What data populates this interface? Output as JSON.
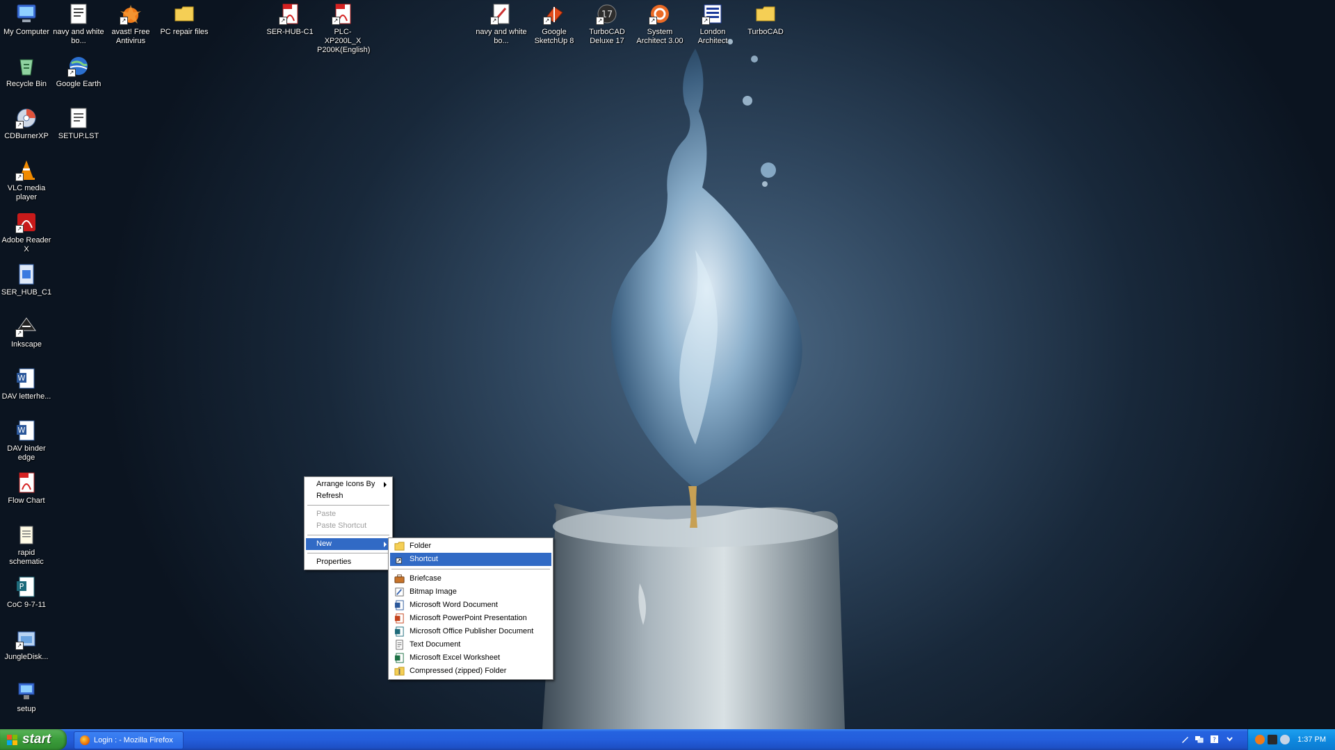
{
  "desktop": {
    "icons": [
      {
        "label": "My Computer",
        "icon": "computer-icon"
      },
      {
        "label": "navy and white bo...",
        "icon": "document-icon"
      },
      {
        "label": "avast! Free Antivirus",
        "icon": "avast-icon"
      },
      {
        "label": "PC repair files",
        "icon": "folder-icon"
      },
      {
        "label": "SER-HUB-C1",
        "icon": "pdf-icon"
      },
      {
        "label": "PLC-XP200L_X P200K(English)",
        "icon": "pdf-icon"
      },
      {
        "label": "navy and white bo...",
        "icon": "document-icon"
      },
      {
        "label": "Google SketchUp 8",
        "icon": "sketchup-icon"
      },
      {
        "label": "TurboCAD Deluxe 17",
        "icon": "turbocad-icon"
      },
      {
        "label": "System Architect 3.00",
        "icon": "architect-icon"
      },
      {
        "label": "London Architect",
        "icon": "london-architect-icon"
      },
      {
        "label": "TurboCAD",
        "icon": "folder-icon"
      },
      {
        "label": "Recycle Bin",
        "icon": "recycle-bin-icon"
      },
      {
        "label": "Google Earth",
        "icon": "globe-icon"
      },
      {
        "label": "CDBurnerXP",
        "icon": "disc-icon"
      },
      {
        "label": "SETUP.LST",
        "icon": "text-file-icon"
      },
      {
        "label": "VLC media player",
        "icon": "vlc-cone-icon"
      },
      {
        "label": "Adobe Reader X",
        "icon": "adobe-reader-icon"
      },
      {
        "label": "SER_HUB_C1",
        "icon": "setup-file-icon"
      },
      {
        "label": "Inkscape",
        "icon": "inkscape-icon"
      },
      {
        "label": "DAV letterhe...",
        "icon": "word-document-icon"
      },
      {
        "label": "DAV binder edge",
        "icon": "word-document-icon"
      },
      {
        "label": "Flow Chart",
        "icon": "pdf-icon"
      },
      {
        "label": "rapid schematic",
        "icon": "notepad-icon"
      },
      {
        "label": "CoC 9-7-11",
        "icon": "publisher-icon"
      },
      {
        "label": "JungleDisk...",
        "icon": "installer-icon"
      },
      {
        "label": "setup",
        "icon": "setup-icon"
      }
    ]
  },
  "context_menu": {
    "items": [
      {
        "label": "Arrange Icons By"
      },
      {
        "label": "Refresh"
      },
      {
        "label": "Paste"
      },
      {
        "label": "Paste Shortcut"
      },
      {
        "label": "New"
      },
      {
        "label": "Properties"
      }
    ]
  },
  "new_submenu": {
    "items": [
      {
        "label": "Folder",
        "icon": "folder-icon"
      },
      {
        "label": "Shortcut",
        "icon": "shortcut-icon"
      },
      {
        "label": "Briefcase",
        "icon": "briefcase-icon"
      },
      {
        "label": "Bitmap Image",
        "icon": "paint-icon"
      },
      {
        "label": "Microsoft Word Document",
        "icon": "word-icon"
      },
      {
        "label": "Microsoft PowerPoint Presentation",
        "icon": "powerpoint-icon"
      },
      {
        "label": "Microsoft Office Publisher Document",
        "icon": "publisher-icon"
      },
      {
        "label": "Text Document",
        "icon": "text-document-icon"
      },
      {
        "label": "Microsoft Excel Worksheet",
        "icon": "excel-icon"
      },
      {
        "label": "Compressed (zipped) Folder",
        "icon": "zip-folder-icon"
      }
    ]
  },
  "taskbar": {
    "start_label": "start",
    "task_button_label": "Login : - Mozilla Firefox",
    "clock": "1:37 PM"
  },
  "colors": {
    "taskbar_blue": "#245edc",
    "start_green": "#3c9e3c",
    "menu_highlight": "#316ac5",
    "tray_blue": "#0f8ae0"
  }
}
